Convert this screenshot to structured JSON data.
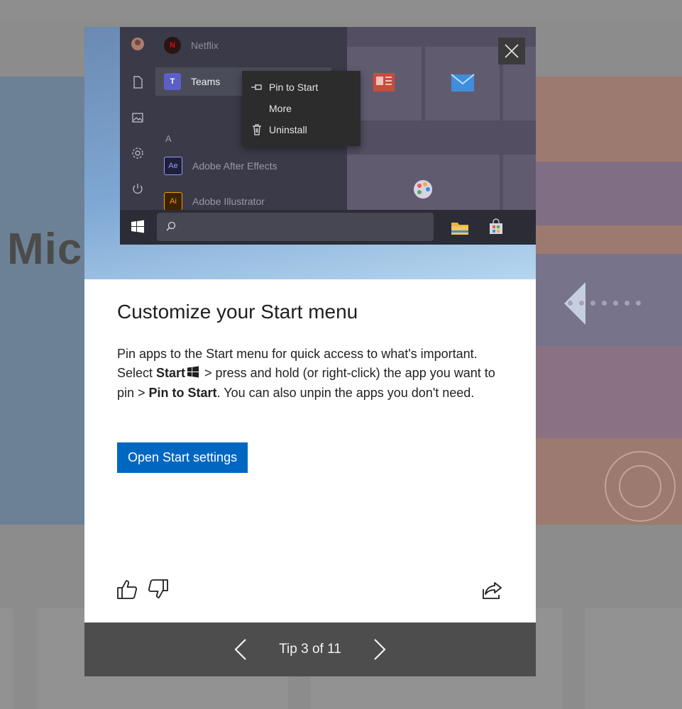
{
  "background": {
    "hero_title": "Micr"
  },
  "dialog": {
    "hero": {
      "start_menu": {
        "apps": [
          {
            "label": "Netflix",
            "badge": "N",
            "badge_color": "#e50914"
          },
          {
            "label": "Teams",
            "badge": "T",
            "badge_color": "#5b5fc7"
          },
          {
            "label": "Adobe  After Effects",
            "badge": "Ae",
            "badge_color": "#9999ff"
          },
          {
            "label": "Adobe  Illustrator",
            "badge": "Ai",
            "badge_color": "#ff9a00"
          }
        ],
        "section_letter": "A",
        "context_menu": {
          "pin": "Pin to Start",
          "more": "More",
          "uninstall": "Uninstall"
        }
      }
    },
    "title": "Customize your Start menu",
    "description": {
      "p1": "Pin apps to the Start menu for quick access to what's important. Select ",
      "start_bold": "Start",
      "p2": " > press and hold (or right-click) the app you want to pin > ",
      "pin_bold": "Pin to Start",
      "p3": ". You can also unpin the apps you don't need."
    },
    "primary_button": "Open Start settings",
    "pager": {
      "counter": "Tip 3 of 11"
    }
  },
  "colors": {
    "accent": "#0067c0",
    "pager_bg": "#4d4d4d",
    "close_bg": "#3b3b3b"
  },
  "icons": {
    "close": "close-icon",
    "thumbs_up": "thumbs-up-icon",
    "thumbs_down": "thumbs-down-icon",
    "share": "share-icon",
    "prev": "chevron-left-icon",
    "next": "chevron-right-icon"
  }
}
